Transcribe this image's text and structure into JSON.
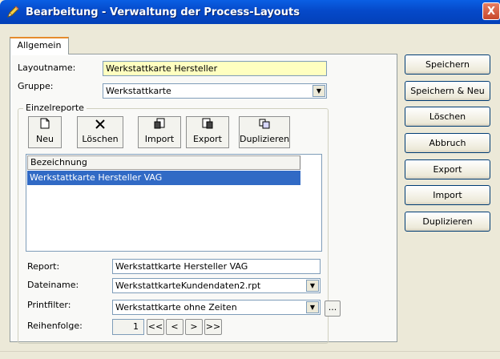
{
  "window": {
    "title": "Bearbeitung - Verwaltung der Process-Layouts",
    "close_label": "X"
  },
  "tabs": [
    {
      "label": "Allgemein",
      "active": true
    }
  ],
  "form": {
    "layoutname_label": "Layoutname:",
    "layoutname_value": "Werkstattkarte Hersteller",
    "gruppe_label": "Gruppe:",
    "gruppe_value": "Werkstattkarte"
  },
  "einzelreporte": {
    "title": "Einzelreporte",
    "toolbar": [
      {
        "label": "Neu",
        "icon": "new-document-icon",
        "glyph": "🗋"
      },
      {
        "label": "Löschen",
        "icon": "delete-x-icon",
        "glyph": "✕"
      },
      {
        "label": "Import",
        "icon": "import-icon",
        "glyph": "🗐"
      },
      {
        "label": "Export",
        "icon": "export-icon",
        "glyph": "🗐"
      },
      {
        "label": "Duplizieren",
        "icon": "duplicate-icon",
        "glyph": "⧉"
      }
    ],
    "list": {
      "column": "Bezeichnung",
      "rows": [
        {
          "name": "Werkstattkarte Hersteller VAG",
          "selected": true
        }
      ]
    },
    "report_label": "Report:",
    "report_value": "Werkstattkarte Hersteller VAG",
    "dateiname_label": "Dateiname:",
    "dateiname_value": "WerkstattkarteKundendaten2.rpt",
    "printfilter_label": "Printfilter:",
    "printfilter_value": "Werkstattkarte ohne Zeiten",
    "printfilter_more": "...",
    "reihenfolge_label": "Reihenfolge:",
    "reihenfolge_value": "1",
    "nav": [
      "<<",
      "<",
      ">",
      ">>"
    ]
  },
  "side_buttons": [
    "Speichern",
    "Speichern & Neu",
    "Löschen",
    "Abbruch",
    "Export",
    "Import",
    "Duplizieren"
  ],
  "colors": {
    "accent": "#0a5fe4",
    "selection": "#316ac5",
    "highlight_input": "#ffffc0",
    "tab_accent": "#e68b2c"
  }
}
